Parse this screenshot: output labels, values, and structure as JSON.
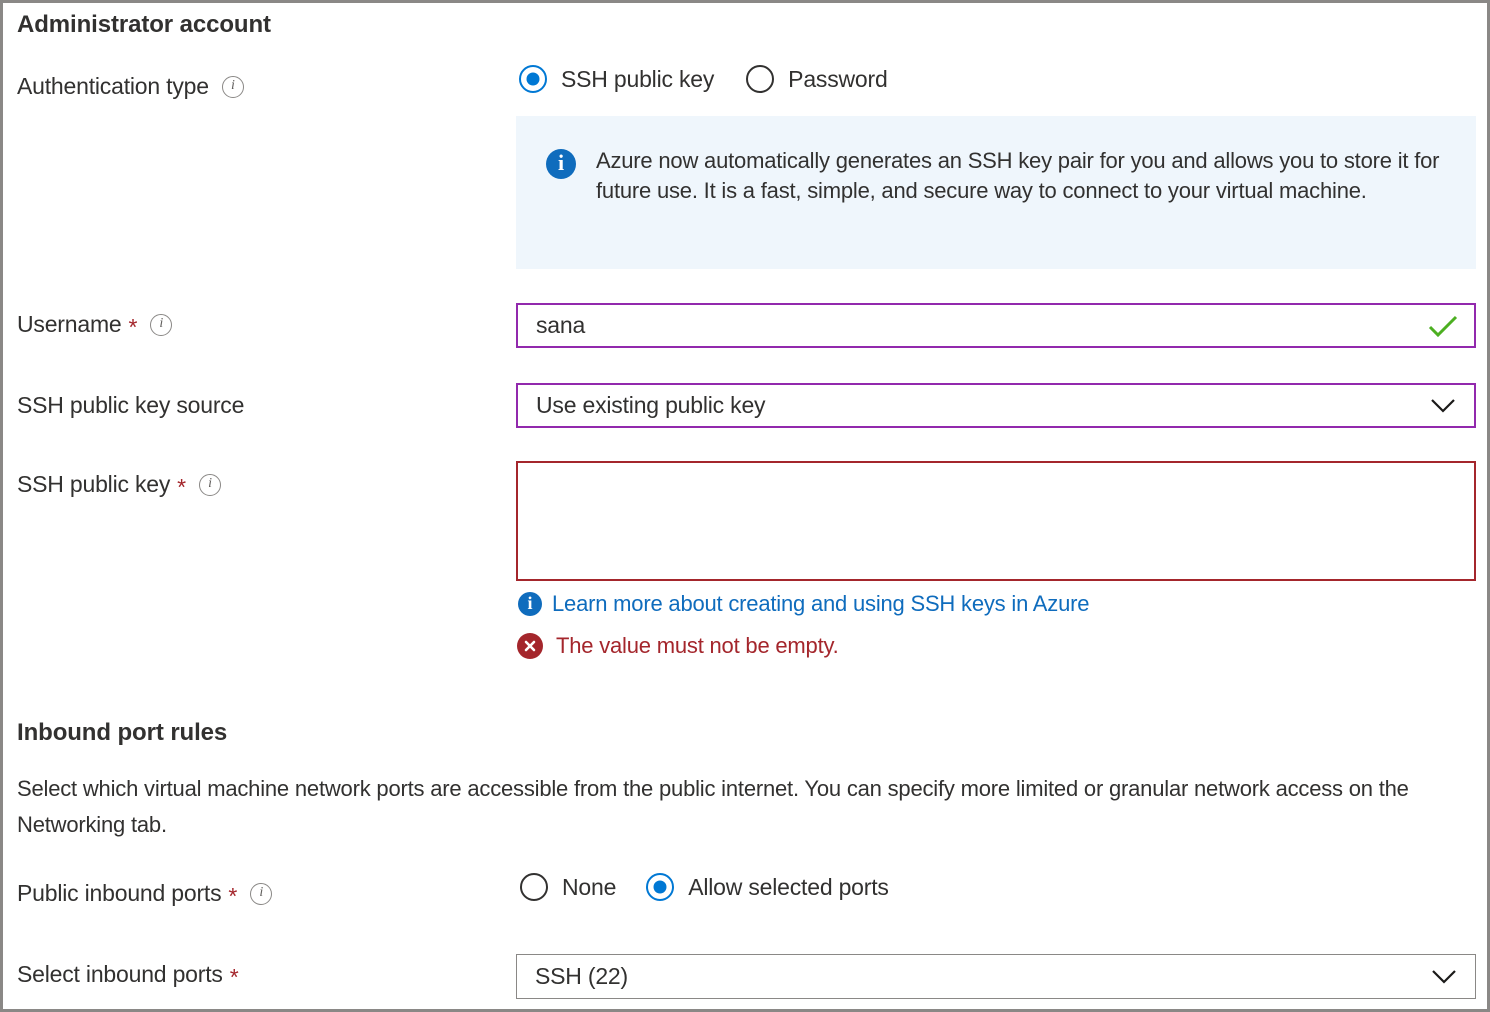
{
  "admin_section": {
    "title": "Administrator account",
    "auth_type": {
      "label": "Authentication type",
      "info_icon": "info-circle-icon",
      "options": [
        {
          "label": "SSH public key",
          "selected": true
        },
        {
          "label": "Password",
          "selected": false
        }
      ]
    },
    "banner": {
      "icon": "info-filled-icon",
      "text": "Azure now automatically generates an SSH key pair for you and allows you to store it for future use. It is a fast, simple, and secure way to connect to your virtual machine.",
      "background_color": "#eff6fc",
      "icon_color": "#0f6cbd"
    },
    "username": {
      "label": "Username",
      "required_marker": "*",
      "info_icon": "info-circle-icon",
      "value": "sana",
      "validation_icon": "checkmark-icon",
      "validation_color": "#4caf21",
      "border_color": "#9229ad"
    },
    "key_source": {
      "label": "SSH public key source",
      "value": "Use existing public key",
      "chevron_icon": "chevron-down-icon",
      "border_color": "#9229ad"
    },
    "public_key": {
      "label": "SSH public key",
      "required_marker": "*",
      "info_icon": "info-circle-icon",
      "value": "",
      "border_color": "#a4262c",
      "link": {
        "icon": "info-filled-icon",
        "text": "Learn more about creating and using SSH keys in Azure",
        "color": "#0f6cbd"
      },
      "error": {
        "icon": "error-circle-icon",
        "text": "The value must not be empty.",
        "color": "#a4262c"
      }
    }
  },
  "inbound_section": {
    "title": "Inbound port rules",
    "description": "Select which virtual machine network ports are accessible from the public internet. You can specify more limited or granular network access on the Networking tab.",
    "public_ports": {
      "label": "Public inbound ports",
      "required_marker": "*",
      "info_icon": "info-circle-icon",
      "options": [
        {
          "label": "None",
          "selected": false
        },
        {
          "label": "Allow selected ports",
          "selected": true
        }
      ]
    },
    "select_ports": {
      "label": "Select inbound ports",
      "required_marker": "*",
      "value": "SSH (22)",
      "chevron_icon": "chevron-down-icon",
      "border_color": "#8a8886"
    }
  }
}
